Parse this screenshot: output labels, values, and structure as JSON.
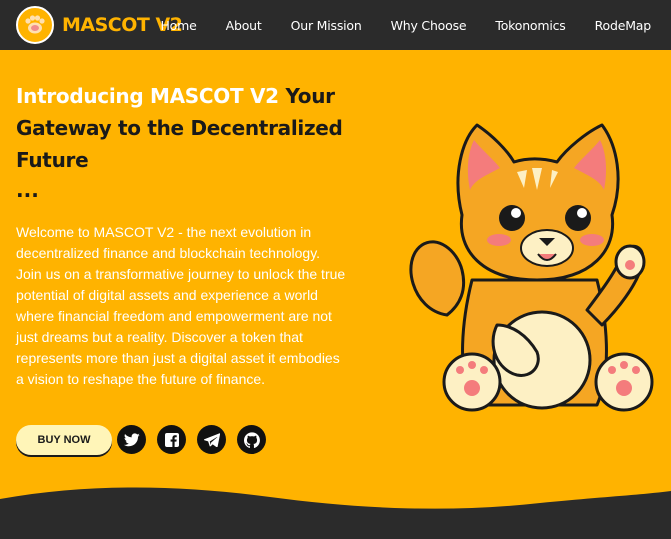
{
  "brand": {
    "name": "MASCOT V2",
    "logo_icon": "cat-paw-icon"
  },
  "nav": {
    "items": [
      {
        "label": "Home"
      },
      {
        "label": "About"
      },
      {
        "label": "Our Mission"
      },
      {
        "label": "Why Choose"
      },
      {
        "label": "Tokonomics"
      },
      {
        "label": "RodeMap"
      }
    ]
  },
  "hero": {
    "title_highlight": "Introducing MASCOT V2",
    "title_rest": " Your Gateway to the Decentralized Future",
    "title_ellipsis": "...",
    "description": "Welcome to MASCOT V2 - the next evolution in decentralized finance and blockchain technology. Join us on a transformative journey to unlock the true potential of digital assets and experience a world where financial freedom and empowerment are not just dreams but a reality. Discover a token that represents more than just a digital asset it embodies a vision to reshape the future of finance.",
    "buy_button": "BUY NOW",
    "socials": [
      {
        "icon": "twitter-icon"
      },
      {
        "icon": "facebook-icon"
      },
      {
        "icon": "telegram-icon"
      },
      {
        "icon": "github-icon"
      }
    ],
    "mascot_icon": "cat-mascot-icon"
  },
  "colors": {
    "accent": "#ffb300",
    "background_dark": "#2b2b2b",
    "button_bg": "#fff5b8",
    "text_dark": "#1a1a1a"
  }
}
